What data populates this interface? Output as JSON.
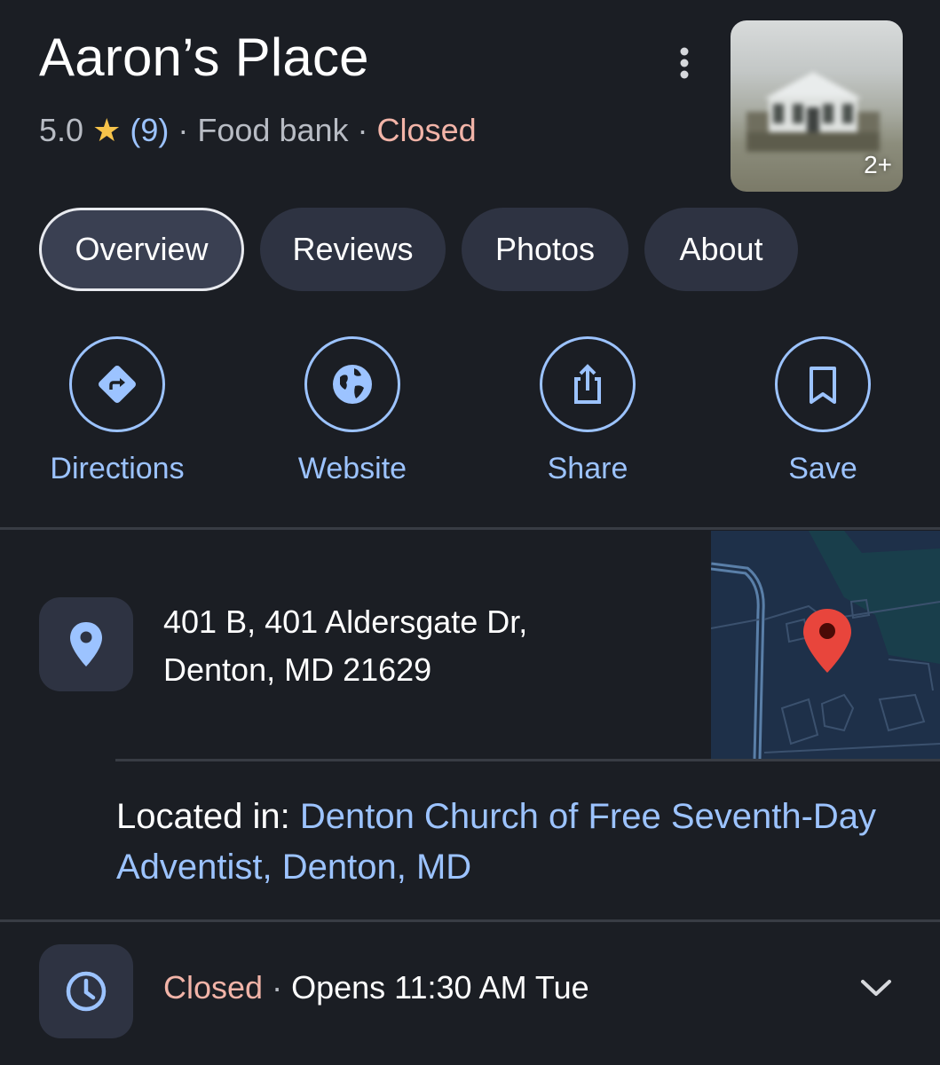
{
  "place": {
    "name": "Aaron’s Place",
    "rating": "5.0",
    "star": "★",
    "review_count": "(9)",
    "separator": "·",
    "category": "Food bank",
    "status": "Closed"
  },
  "thumbnail": {
    "more_label": "2+"
  },
  "tabs": [
    {
      "label": "Overview",
      "active": true
    },
    {
      "label": "Reviews"
    },
    {
      "label": "Photos"
    },
    {
      "label": "About"
    }
  ],
  "actions": [
    {
      "label": "Directions",
      "icon": "directions-icon"
    },
    {
      "label": "Website",
      "icon": "globe-icon"
    },
    {
      "label": "Share",
      "icon": "share-icon"
    },
    {
      "label": "Save",
      "icon": "bookmark-icon"
    }
  ],
  "address": {
    "line1": "401 B, 401 Aldersgate Dr,",
    "line2": "Denton, MD 21629"
  },
  "located_in": {
    "prefix": "Located in: ",
    "link_line1": "Denton Church of Free Seventh-Day",
    "link_line2": "Adventist, Denton, MD"
  },
  "hours": {
    "status": "Closed",
    "separator": " · ",
    "opens": "Opens 11:30 AM Tue"
  },
  "colors": {
    "background": "#1b1e24",
    "accent": "#9cc3ff",
    "closed": "#f2b4a8",
    "star": "#f6c34a",
    "map_pin": "#e8453c"
  }
}
